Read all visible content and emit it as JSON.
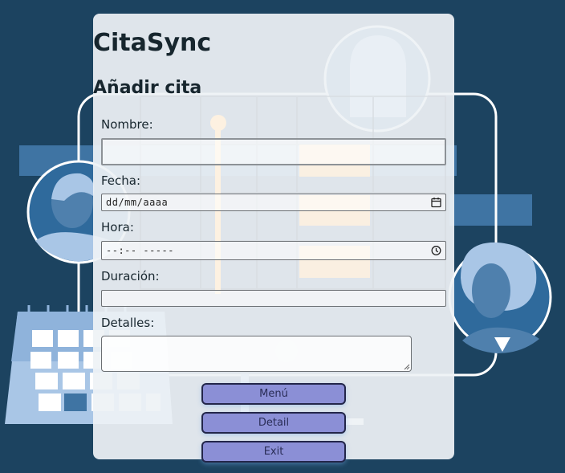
{
  "app": {
    "title": "CitaSync"
  },
  "form": {
    "title": "Añadir cita",
    "nombre": {
      "label": "Nombre:",
      "value": ""
    },
    "fecha": {
      "label": "Fecha:",
      "placeholder": "dd/mm/aaaa",
      "icon": "calendar-icon"
    },
    "hora": {
      "label": "Hora:",
      "placeholder": "--:-- -----",
      "icon": "clock-icon"
    },
    "duracion": {
      "label": "Duración:",
      "value": ""
    },
    "detalles": {
      "label": "Detalles:",
      "value": ""
    }
  },
  "buttons": {
    "menu": "Menú",
    "detail": "Detail",
    "exit": "Exit"
  },
  "colors": {
    "background": "#1c4360",
    "button": "#8b8fd6",
    "accent_light": "#9fbde0"
  }
}
